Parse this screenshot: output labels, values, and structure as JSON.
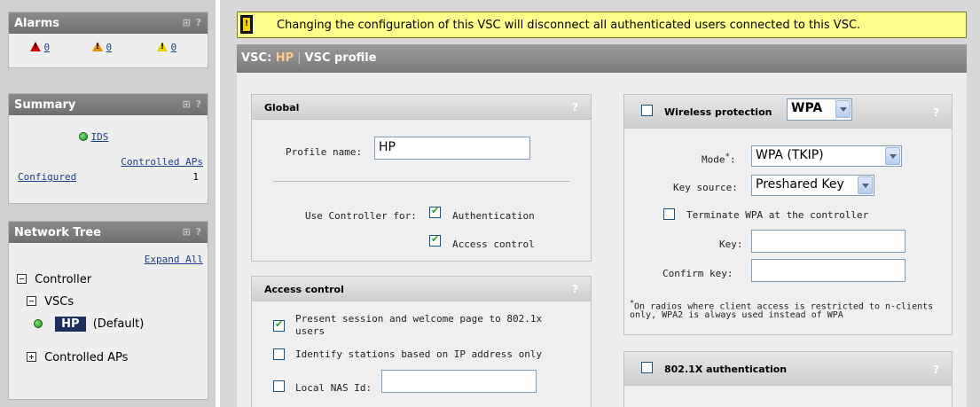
{
  "sidebar": {
    "alarms": {
      "title": "Alarms",
      "tools": "⊞ ?",
      "critical_count": "0",
      "major_count": "0",
      "minor_count": "0"
    },
    "summary": {
      "title": "Summary",
      "tools": "⊞ ?",
      "ids_label": "IDS",
      "controlled_aps_header": "Controlled APs",
      "configured_label": "Configured",
      "configured_value": "1"
    },
    "network_tree": {
      "title": "Network Tree",
      "tools": "⊞ ?",
      "expand_all": "Expand All",
      "controller": "Controller",
      "vscs": "VSCs",
      "vsc_name": "HP",
      "vsc_default": "(Default)",
      "controlled_aps": "Controlled APs"
    }
  },
  "warning": {
    "text": "Changing the configuration of this VSC will disconnect all authenticated users connected to this VSC."
  },
  "title_bar": {
    "prefix": "VSC: ",
    "vsc_name": "HP",
    "separator": "|",
    "page": "VSC profile"
  },
  "global": {
    "title": "Global",
    "help": "?",
    "profile_name_label": "Profile name:",
    "profile_name_value": "HP",
    "use_controller_label": "Use Controller for:",
    "authentication_label": "Authentication",
    "authentication_checked": true,
    "access_control_label": "Access control",
    "access_control_checked": true
  },
  "access_control": {
    "title": "Access control",
    "help": "?",
    "present_session_label_1": "Present session and welcome page to 802.1x",
    "present_session_label_2": "users",
    "present_session_checked": true,
    "identify_stations_label": "Identify stations based on IP address only",
    "identify_stations_checked": false,
    "local_nas_label": "Local NAS Id:",
    "local_nas_checked": false,
    "local_nas_value": ""
  },
  "wireless_protection": {
    "title": "Wireless protection",
    "help": "?",
    "enabled": false,
    "type_value": "WPA",
    "mode_label": "Mode",
    "mode_value": "WPA (TKIP)",
    "key_source_label": "Key source:",
    "key_source_value": "Preshared Key",
    "terminate_label": "Terminate WPA at the controller",
    "terminate_checked": false,
    "key_label": "Key:",
    "key_value": "",
    "confirm_key_label": "Confirm key:",
    "confirm_key_value": "",
    "footnote_line_1": "On radios where client access is restricted to n-clients",
    "footnote_line_2": "only, WPA2 is always used instead of WPA"
  },
  "dot1x": {
    "title": "802.1X authentication",
    "help": "?",
    "enabled": false
  },
  "colors": {
    "panel_header": "#7d7d7d",
    "warning_bg": "#ffff8c",
    "link": "#1a3d8c",
    "vsc_accent": "#ffc98a"
  }
}
